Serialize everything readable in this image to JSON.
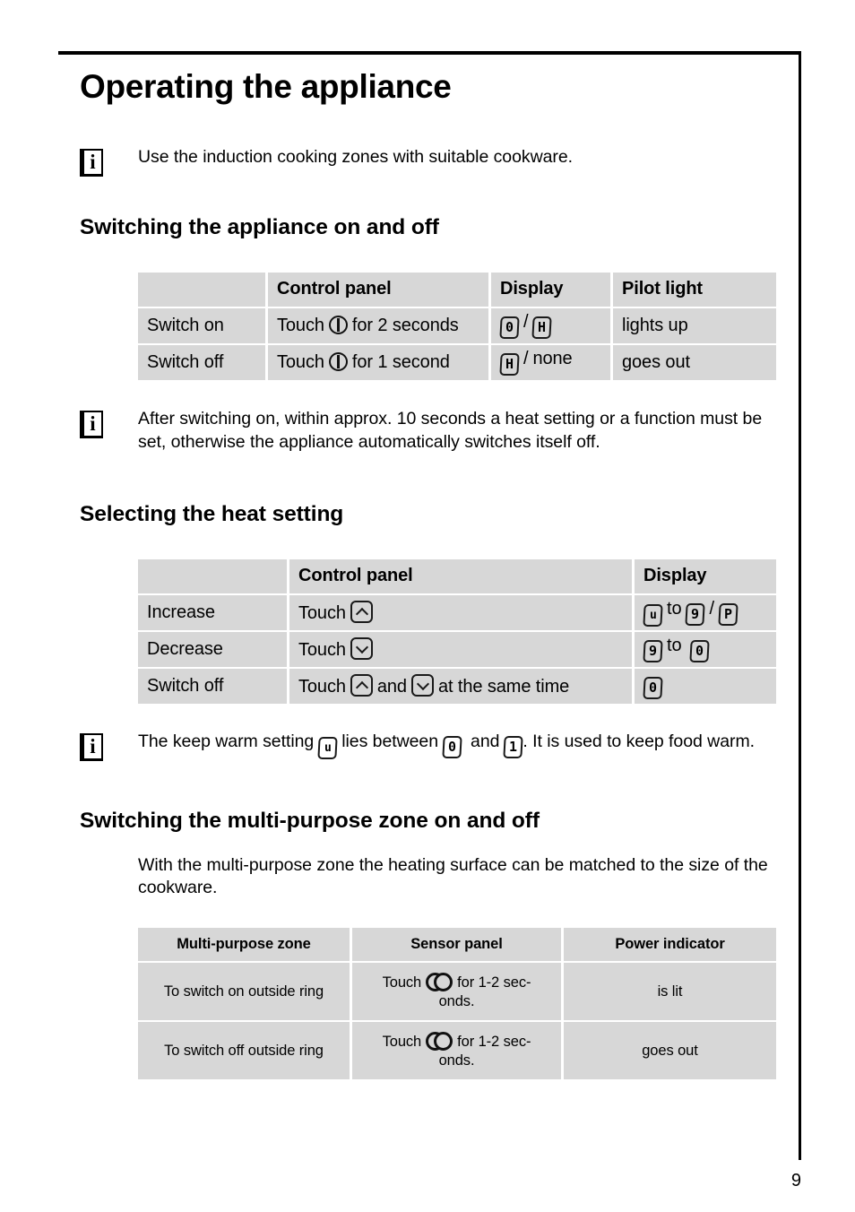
{
  "page": {
    "title": "Operating the appliance",
    "number": "9"
  },
  "intro_note": {
    "icon": "info-icon",
    "text": "Use the induction cooking zones with suitable cookware."
  },
  "section_switch": {
    "heading": "Switching the appliance on and off",
    "table": {
      "headers": [
        "",
        "Control panel",
        "Display",
        "Pilot light"
      ],
      "rows": [
        {
          "action": "Switch on",
          "control_prefix": "Touch",
          "control_icon": "power-icon",
          "control_suffix": "for 2 seconds",
          "display": [
            "0",
            "/",
            "H"
          ],
          "pilot": "lights up"
        },
        {
          "action": "Switch off",
          "control_prefix": "Touch",
          "control_icon": "power-icon",
          "control_suffix": "for 1 second",
          "display": [
            "H",
            "/",
            "none"
          ],
          "pilot": "goes out"
        }
      ]
    }
  },
  "note_autoswitch": {
    "icon": "info-icon",
    "text": "After switching on, within approx. 10 seconds a heat setting or a function must be set, otherwise the appliance automatically switches itself off."
  },
  "section_heat": {
    "heading": "Selecting the heat setting",
    "table": {
      "headers": [
        "",
        "Control panel",
        "Display"
      ],
      "rows": [
        {
          "action": "Increase",
          "control_prefix": "Touch",
          "control_icon": "chevron-up-icon",
          "control_mid": "",
          "control_icon2": "",
          "control_suffix": "",
          "display_from": "u",
          "display_to_word": "to",
          "display_to": "9",
          "display_slash": "/",
          "display_alt": "P"
        },
        {
          "action": "Decrease",
          "control_prefix": "Touch",
          "control_icon": "chevron-down-icon",
          "control_mid": "",
          "control_icon2": "",
          "control_suffix": "",
          "display_from": "9",
          "display_to_word": "to",
          "display_to": "0",
          "display_slash": "",
          "display_alt": ""
        },
        {
          "action": "Switch off",
          "control_prefix": "Touch",
          "control_icon": "chevron-up-icon",
          "control_mid": "and",
          "control_icon2": "chevron-down-icon",
          "control_suffix": "at the same time",
          "display_from": "0",
          "display_to_word": "",
          "display_to": "",
          "display_slash": "",
          "display_alt": ""
        }
      ]
    }
  },
  "note_keepwarm": {
    "icon": "info-icon",
    "text_part1": "The keep warm setting",
    "chip1": "u",
    "text_part2": "lies between",
    "chip2": "0",
    "text_part3": "and",
    "chip3": "1",
    "text_part4": ". It is used to keep food warm."
  },
  "section_multipurpose": {
    "heading": "Switching the multi-purpose zone on and off",
    "paragraph": "With the multi-purpose zone the heating surface can be matched to the size of the cookware.",
    "table": {
      "headers": [
        "Multi-purpose zone",
        "Sensor panel",
        "Power indicator"
      ],
      "rows": [
        {
          "zone": "To switch on outside  ring",
          "sensor_prefix": "Touch",
          "sensor_icon": "multi-zone-ring-icon",
          "sensor_suffix_line1": "for 1-2 sec-",
          "sensor_suffix_line2": "onds.",
          "indicator": "is lit"
        },
        {
          "zone": "To switch off outside  ring",
          "sensor_prefix": "Touch",
          "sensor_icon": "multi-zone-ring-icon",
          "sensor_suffix_line1": "for 1-2 sec-",
          "sensor_suffix_line2": "onds.",
          "indicator": "goes out"
        }
      ]
    }
  },
  "colors": {
    "table_cell_bg": "#d7d7d7",
    "text": "#000000",
    "rule": "#000000"
  }
}
